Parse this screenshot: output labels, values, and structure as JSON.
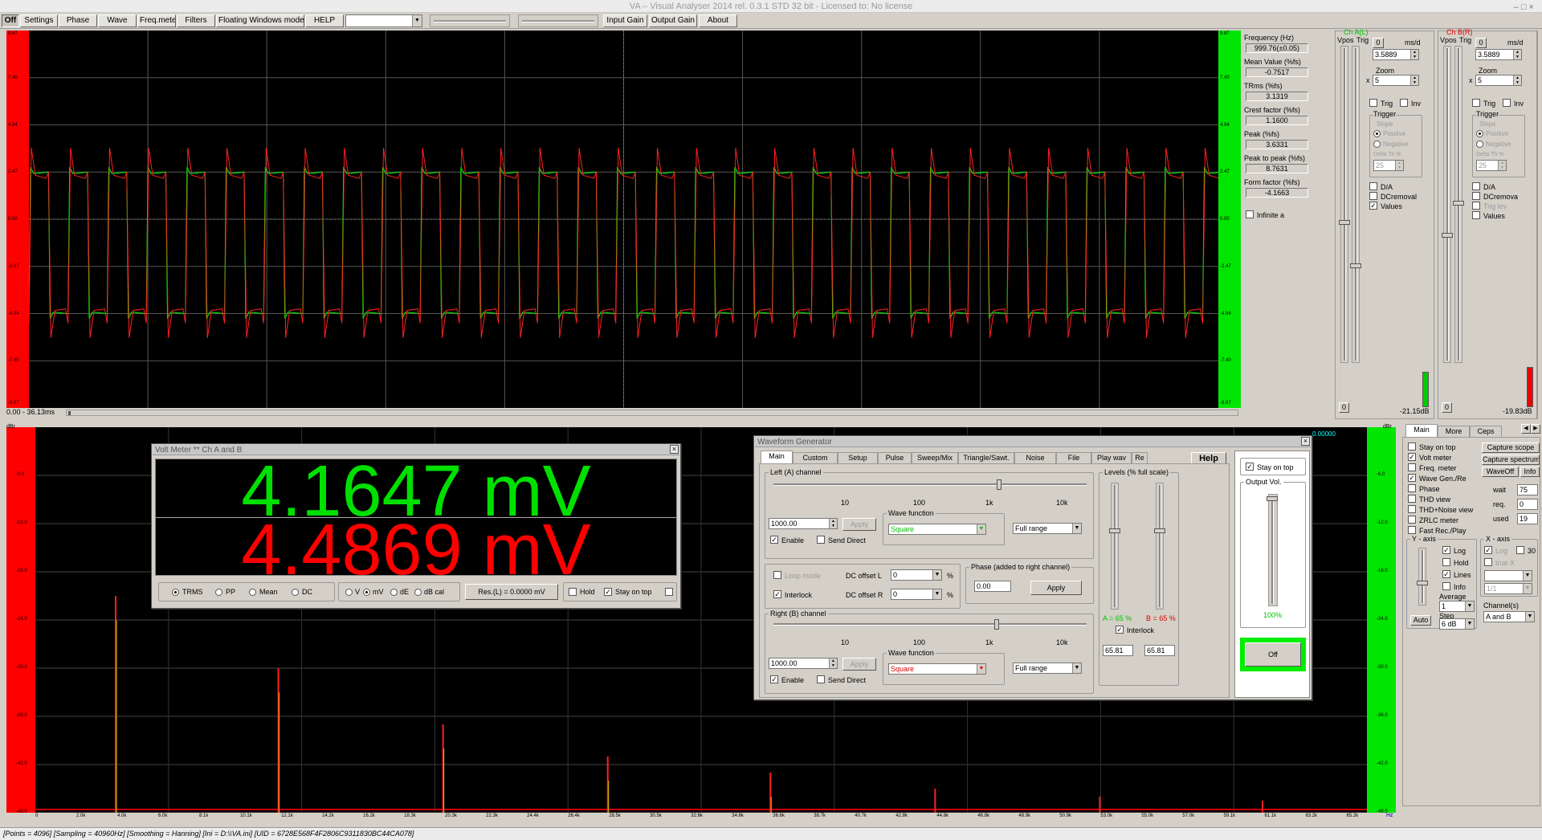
{
  "window": {
    "title": "VA – Visual Analyser 2014 rel. 0.3.1 STD 32 bit - Licensed to: No license",
    "controls": "–  □  ×"
  },
  "toolbar": {
    "off": "Off",
    "settings": "Settings",
    "phase": "Phase",
    "wave": "Wave",
    "freq": "Freq.meter",
    "filters": "Filters",
    "floating": "Floating Windows mode",
    "help": "HELP",
    "input_gain": "Input Gain",
    "output_gain": "Output Gain",
    "about": "About"
  },
  "scope": {
    "ticks_left": [
      "9.87",
      "7.40",
      "4.94",
      "2.47",
      "0.00",
      "-2.47",
      "-4.94",
      "-7.40",
      "-9.87"
    ],
    "ticks_right": [
      "9.87",
      "7.40",
      "4.94",
      "2.47",
      "0.00",
      "-2.47",
      "-4.94",
      "-7.40",
      "-9.87"
    ],
    "time_range": "0.00 - 36.13ms",
    "square_high": 2.47,
    "square_low": -4.94,
    "cycles": 30
  },
  "measures": {
    "items": [
      {
        "label": "Frequency (Hz)",
        "value": "999.76(±0.05)"
      },
      {
        "label": "Mean Value (%fs)",
        "value": "-0.7517"
      },
      {
        "label": "TRms (%fs)",
        "value": "3.1319"
      },
      {
        "label": "Crest factor (%fs)",
        "value": "1.1600"
      },
      {
        "label": "Peak (%fs)",
        "value": "3.6331"
      },
      {
        "label": "Peak to peak (%fs)",
        "value": "8.7631"
      },
      {
        "label": "Form factor (%fs)",
        "value": "-4.1663"
      }
    ],
    "infinite": "Infinite a"
  },
  "chA": {
    "title": "Ch A(L)",
    "vpos": "Vpos",
    "trig": "Trig",
    "zero": "0",
    "ms_div": "ms/d",
    "ms_val": "3.5889",
    "zoom": "Zoom",
    "zoom_x": "x",
    "zoom_val": "5",
    "trig_chk": "Trig",
    "inv": "Inv",
    "trigger": "Trigger",
    "slope": "Slope",
    "positive": "Positive",
    "negative": "Negative",
    "delta": "Delta Th %",
    "delta_val": "25",
    "da": "D/A",
    "dcremoval": "DCremoval",
    "values": "Values",
    "zero_btn": "0",
    "db": "-21.15dB"
  },
  "chB": {
    "title": "Ch B(R)",
    "vpos": "Vpos",
    "trig": "Trig",
    "zero": "0",
    "ms_div": "ms/d",
    "ms_val": "3.5889",
    "zoom": "Zoom",
    "zoom_x": "x",
    "zoom_val": "5",
    "trig_chk": "Trig",
    "inv": "Inv",
    "trigger": "Trigger",
    "slope": "Slope",
    "positive": "Positive",
    "negative": "Negative",
    "delta": "Delta Th %",
    "delta_val": "25",
    "da": "D/A",
    "dcremoval": "DCremova",
    "triglev": "Trig lev",
    "values": "Values",
    "zero_btn": "0",
    "db": "-19.83dB"
  },
  "spectrum": {
    "unit_left": "dBr",
    "unit_right": "dBr",
    "hz": "Hz",
    "ticks_y": [
      "-6.0",
      "-12.0",
      "-18.0",
      "-24.0",
      "-30.0",
      "-36.0",
      "-42.0",
      "-48.0"
    ],
    "ticks_x": [
      "0",
      "2.0k",
      "4.0k",
      "6.0k",
      "8.1k",
      "10.1k",
      "12.1k",
      "14.2k",
      "16.2k",
      "18.3k",
      "20.3k",
      "22.3k",
      "24.4k",
      "26.4k",
      "28.5k",
      "30.5k",
      "32.6k",
      "34.6k",
      "36.6k",
      "38.7k",
      "40.7k",
      "42.8k",
      "44.8k",
      "46.8k",
      "48.9k",
      "50.9k",
      "53.0k",
      "55.0k",
      "57.0k",
      "59.1k",
      "61.1k",
      "63.2k",
      "65.2k"
    ],
    "top_right": "0.00000",
    "harmonics": [
      {
        "f": 4.0,
        "db": -21
      },
      {
        "f": 12.1,
        "db": -30
      },
      {
        "f": 20.3,
        "db": -37
      },
      {
        "f": 28.5,
        "db": -41
      },
      {
        "f": 36.6,
        "db": -43
      },
      {
        "f": 44.8,
        "db": -45
      },
      {
        "f": 53.0,
        "db": -46
      },
      {
        "f": 61.1,
        "db": -46.5
      }
    ]
  },
  "voltmeter": {
    "title": "Volt Meter ** Ch A and B",
    "value_a": "4.1647 mV",
    "value_b": "4.4869 mV",
    "trms": "TRMS",
    "pp": "PP",
    "mean": "Mean",
    "dc": "DC",
    "v": "V",
    "mv": "mV",
    "de": "dE",
    "dbcal": "dB cal",
    "res": "Res.(L) = 0.0000 mV",
    "hold": "Hold",
    "stay": "Stay on top"
  },
  "wavegen": {
    "title": "Waveform Generator",
    "help": "Help",
    "tabs": [
      "Main",
      "Custom",
      "Setup",
      "Pulse",
      "Sweep/Mix",
      "Triangle/Sawt.",
      "Noise",
      "File",
      "Play wav",
      "Re"
    ],
    "left": "Left (A) channel",
    "right": "Right (B) channel",
    "scale": [
      "10",
      "100",
      "1k",
      "10k"
    ],
    "freq_l": "1000.00",
    "freq_r": "1000.00",
    "apply": "Apply",
    "enable": "Enable",
    "send_direct": "Send Direct",
    "wave_function": "Wave function",
    "wave_l": "Square",
    "wave_r": "Square",
    "range": "Full range",
    "loop": "Loop mode",
    "interlock": "Interlock",
    "dc_l": "DC offset L",
    "dc_r": "DC offset R",
    "dc_l_val": "0",
    "dc_r_val": "0",
    "pct": "%",
    "phase": "Phase (added to right channel)",
    "phase_val": "0.00",
    "phase_apply": "Apply",
    "levels": "Levels (% full scale)",
    "a_pct": "A = 65 %",
    "b_pct": "B = 65 %",
    "lev_interlock": "Interlock",
    "lev_a": "65.81",
    "lev_b": "65.81",
    "stay": "Stay on top",
    "outvol": "Output Vol.",
    "outvol_val": "100%",
    "off": "Off"
  },
  "side": {
    "tabs": [
      "Main",
      "More",
      "Ceps"
    ],
    "checks": [
      {
        "l": "Stay on top",
        "c": false
      },
      {
        "l": "Volt meter",
        "c": true
      },
      {
        "l": "Freq. meter",
        "c": false
      },
      {
        "l": "Wave Gen./Re",
        "c": true
      },
      {
        "l": "Phase",
        "c": false
      },
      {
        "l": "THD view",
        "c": false
      },
      {
        "l": "THD+Noise view",
        "c": false
      },
      {
        "l": "ZRLC meter",
        "c": false
      },
      {
        "l": "Fast Rec./Play",
        "c": false
      }
    ],
    "capture_scope": "Capture scope",
    "capture_spectrum": "Capture spectrum",
    "waveoff": "WaveOff",
    "info": "Info",
    "wait": "wait",
    "wait_v": "75",
    "req": "req.",
    "req_v": "0",
    "used": "used",
    "used_v": "19",
    "yaxis": "Y - axis",
    "xaxis": "X - axis",
    "log": "Log",
    "hold": "Hold",
    "lines": "Lines",
    "yinfo": "Info",
    "average": "Average",
    "avg_v": "1",
    "step": "Step",
    "step_v": "6 dB",
    "auto": "Auto",
    "xlog": "Log",
    "x30": "30",
    "truex": "true X",
    "xfrac": "1/1",
    "channels": "Channel(s)",
    "chan_v": "A and B"
  },
  "status": "[Points = 4096]  [Sampling = 40960Hz]  [Smoothing = Hanning]  [Ini = D:\\\\VA.ini]  [UID = 6728E568F4F2806C9311830BC44CA078]"
}
